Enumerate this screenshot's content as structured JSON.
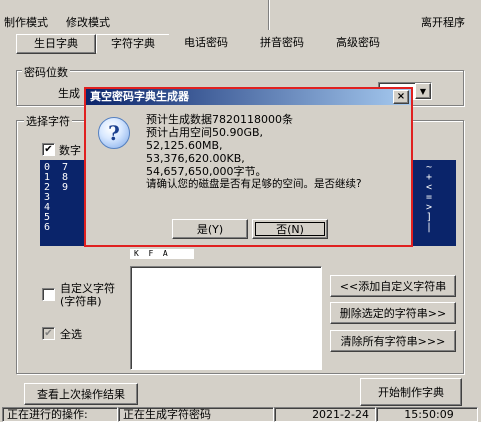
{
  "menu": {
    "items": [
      "制作模式",
      "修改模式"
    ],
    "exit": "离开程序"
  },
  "tabs": [
    "生日字典",
    "字符字典",
    "电话密码",
    "拼音密码",
    "高级密码"
  ],
  "password_group": {
    "title": "密码位数",
    "gen_label": "生成"
  },
  "charset_group": {
    "title": "选择字符",
    "digits_checkbox": "数字",
    "digits_checked": true
  },
  "list_left": [
    "0  7",
    "1  8",
    "2  9",
    "3",
    "4",
    "5",
    "6"
  ],
  "list_right": [
    "  ~",
    "  +",
    "  <",
    "  =",
    "  >",
    "  ]",
    "  |"
  ],
  "list_bottom_row": "K  F  A",
  "custom": {
    "checkbox_label_1": "自定义字符",
    "checkbox_label_2": "(字符串)",
    "custom_checked": false,
    "select_all_label": "全选",
    "select_all_checked": true,
    "add_button": "<<添加自定义字符串",
    "delete_button": "删除选定的字符串>>",
    "clear_button": "清除所有字符串>>>"
  },
  "bottom": {
    "view_last": "查看上次操作结果",
    "start": "开始制作字典"
  },
  "statusbar": {
    "label": "正在进行的操作:",
    "operation": "正在生成字符密码",
    "date": "2021-2-24",
    "time": "15:50:09"
  },
  "dialog": {
    "title": "真空密码字典生成器",
    "close_glyph": "×",
    "icon_glyph": "?",
    "lines": [
      "预计生成数据7820118000条",
      "预计占用空间50.90GB,",
      "52,125.60MB,",
      "53,376,620.00KB,",
      "54,657,650,000字节。",
      "请确认您的磁盘是否有足够的空间。是否继续?"
    ],
    "yes_button": "是(Y)",
    "no_button": "否(N)"
  },
  "colors": {
    "face": "#d4d0c8",
    "selection": "#0a246a",
    "highlight_border": "#e02020"
  }
}
